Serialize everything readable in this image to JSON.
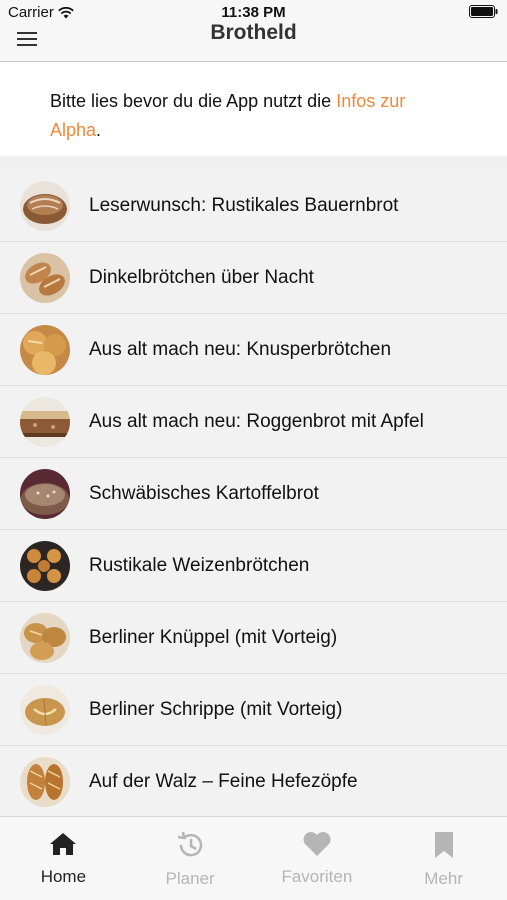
{
  "status": {
    "carrier": "Carrier",
    "time": "11:38 PM"
  },
  "nav": {
    "title": "Brotheld",
    "menu_icon": "hamburger-menu-icon"
  },
  "notice": {
    "text": "Bitte lies bevor du die App nutzt die ",
    "link": "Infos zur Alpha",
    "after": ".",
    "link_color": "#f0893a"
  },
  "recipes": [
    {
      "title": "Leserwunsch: Rustikales Bauernbrot",
      "thumb": "bread-loaf"
    },
    {
      "title": "Dinkelbrötchen über Nacht",
      "thumb": "spelt-rolls"
    },
    {
      "title": "Aus alt mach neu: Knusperbrötchen",
      "thumb": "crispy-rolls"
    },
    {
      "title": "Aus alt mach neu: Roggenbrot mit Apfel",
      "thumb": "rye-bread-slice"
    },
    {
      "title": "Schwäbisches Kartoffelbrot",
      "thumb": "potato-bread"
    },
    {
      "title": "Rustikale Weizenbrötchen",
      "thumb": "wheat-rolls-tray"
    },
    {
      "title": "Berliner Knüppel (mit Vorteig)",
      "thumb": "knueppel-rolls"
    },
    {
      "title": "Berliner Schrippe (mit Vorteig)",
      "thumb": "schrippe"
    },
    {
      "title": "Auf der Walz – Feine Hefezöpfe",
      "thumb": "braided-yeast-bread"
    }
  ],
  "tabs": [
    {
      "label": "Home",
      "icon": "home-icon",
      "active": true
    },
    {
      "label": "Planer",
      "icon": "history-clock-icon",
      "active": false
    },
    {
      "label": "Favoriten",
      "icon": "heart-icon",
      "active": false
    },
    {
      "label": "Mehr",
      "icon": "bookmark-icon",
      "active": false
    }
  ],
  "colors": {
    "accent": "#f0893a",
    "tab_active": "#222222",
    "tab_inactive": "#b5b5b5"
  }
}
